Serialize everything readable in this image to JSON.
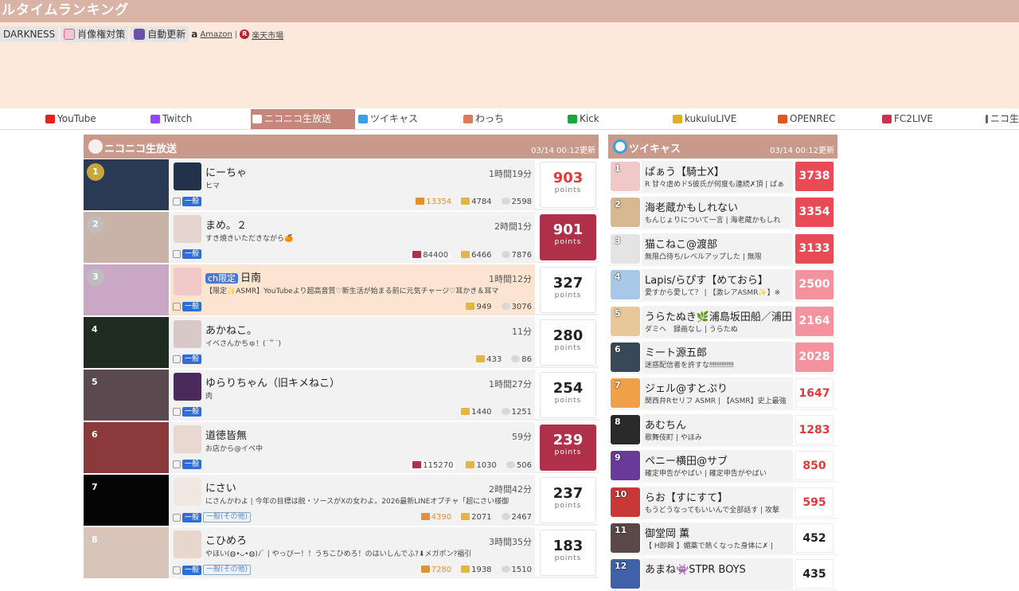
{
  "header": {
    "title": "ルタイムランキング"
  },
  "toolbar": {
    "darkness": "DARKNESS",
    "portrait": "肖像権対策",
    "auto_update": "自動更新",
    "amazon_mark": "a",
    "amazon": "Amazon",
    "separator": "|",
    "rakuten_mark": "R",
    "rakuten": "楽天市場"
  },
  "tabs": [
    {
      "label": "YouTube",
      "icon": "youtube-icon",
      "color": "#e62117"
    },
    {
      "label": "Twitch",
      "icon": "twitch-icon",
      "color": "#9146ff"
    },
    {
      "label": "ニコニコ生放送",
      "icon": "niconico-icon",
      "color": "#ffffff",
      "active": true
    },
    {
      "label": "ツイキャス",
      "icon": "twitcasting-icon",
      "color": "#3aa0e0"
    },
    {
      "label": "わっち",
      "icon": "wacchi-icon",
      "color": "#e07a5a"
    },
    {
      "label": "Kick",
      "icon": "kick-icon",
      "color": "#1aa83a"
    },
    {
      "label": "kukuluLIVE",
      "icon": "kukulu-icon",
      "color": "#e0b020"
    },
    {
      "label": "OPENREC",
      "icon": "openrec-icon",
      "color": "#e05520"
    },
    {
      "label": "FC2LIVE",
      "icon": "fc2-icon",
      "color": "#d03050"
    },
    {
      "label": "ニコ生",
      "icon": "niconico-icon",
      "color": "#666666"
    }
  ],
  "nico": {
    "title": "ニコニコ生放送",
    "updated": "03/14 00:12更新",
    "points_label": "points",
    "rows": [
      {
        "rank": "1",
        "name": "にーちゃ",
        "desc": "ヒマ",
        "time": "1時間19分",
        "tag": "一般",
        "gift": "13354",
        "viewers": "4784",
        "comments": "2598",
        "points": "903",
        "style": "red"
      },
      {
        "rank": "2",
        "name": "まめ。２",
        "desc": "すき焼きいただきながら🍊",
        "time": "2時間1分",
        "tag": "一般",
        "premium": "84400",
        "viewers": "6466",
        "comments": "7876",
        "points": "901",
        "style": "boost"
      },
      {
        "rank": "3",
        "badge": "ch限定",
        "name": "日南",
        "desc": "【限定✨ASMR】YouTubeより超高音質♡新生活が始まる前に元気チャージ♡耳かき＆耳マ",
        "time": "1時間12分",
        "tag": "一般",
        "viewers": "949",
        "comments": "3076",
        "points": "327",
        "style": "plain",
        "highlight": true
      },
      {
        "rank": "4",
        "name": "あかねこ。",
        "desc": "イベさんかちゅ！(˙꒳˙)",
        "time": "11分",
        "tag": "一般",
        "viewers": "433",
        "comments": "86",
        "points": "280",
        "style": "plain"
      },
      {
        "rank": "5",
        "name": "ゆらりちゃん（旧キメねこ）",
        "desc": "肉",
        "time": "1時間27分",
        "tag": "一般",
        "viewers": "1440",
        "comments": "1251",
        "points": "254",
        "style": "plain"
      },
      {
        "rank": "6",
        "name": "道徳皆無",
        "desc": "お店から@イベ中",
        "time": "59分",
        "tag": "一般",
        "premium": "115270",
        "viewers": "1030",
        "comments": "506",
        "points": "239",
        "style": "boost"
      },
      {
        "rank": "7",
        "name": "にさい",
        "desc": "にさんかわよ | 今年の目標は脱・ソースがXの女わよ。2026最新LINEオプチャ「超にさい様御",
        "time": "2時間42分",
        "tag": "一般",
        "tag2": "一般(その他)",
        "gift": "4390",
        "viewers": "2071",
        "comments": "2467",
        "points": "237",
        "style": "plain"
      },
      {
        "rank": "8",
        "name": "こひめろ",
        "desc": "やほい(◍•ᴗ•◍)ﾉﾞ | やっぴー！！うちこひめろ！のはいしんでふ?⬇メガポン?福引",
        "time": "3時間35分",
        "tag": "一般",
        "tag2": "一般(その他)",
        "gift": "7280",
        "viewers": "1938",
        "comments": "1510",
        "points": "183",
        "style": "plain"
      }
    ]
  },
  "twitcas": {
    "title": "ツイキャス",
    "updated": "03/14 00:12更新",
    "rows": [
      {
        "rank": "1",
        "name": "ぱぁう【騎士X】",
        "desc": "R 甘々虐めドS彼氏が何度も連続✗頂 | ぱぁ",
        "points": "3738",
        "style": "red"
      },
      {
        "rank": "2",
        "name": "海老蔵かもしれない",
        "desc": "もんじょりについて一言 | 海老蔵かもしれ",
        "points": "3354",
        "style": "red"
      },
      {
        "rank": "3",
        "name": "猫こねこ@渡部",
        "desc": "無限凸待ち/レベルアップした | 無限",
        "points": "3133",
        "style": "red"
      },
      {
        "rank": "4",
        "name": "Lapis/らぴす【めておら】",
        "desc": "愛すから愛して？ | 【激レアASMR✨】※",
        "points": "2500",
        "style": "pink"
      },
      {
        "rank": "5",
        "name": "うらたぬき🌿浦島坂田船／浦田",
        "desc": "ダミヘ　録画なし | うらたぬ",
        "points": "2164",
        "style": "pink"
      },
      {
        "rank": "6",
        "name": "ミート源五郎",
        "desc": "迷惑配信者を許すな‼‼‼‼‼‼‼",
        "points": "2028",
        "style": "pink"
      },
      {
        "rank": "7",
        "name": "ジェル@すとぷり",
        "desc": "関西弁Rセリフ ASMR | 【ASMR】史上最強",
        "points": "1647",
        "style": "light"
      },
      {
        "rank": "8",
        "name": "あむちん",
        "desc": "歌舞伎町 | やほみ",
        "points": "1283",
        "style": "light"
      },
      {
        "rank": "9",
        "name": "ペニー横田@サブ",
        "desc": "確定申告がやばい | 確定申告がやばい",
        "points": "850",
        "style": "light"
      },
      {
        "rank": "10",
        "name": "らお【すにすて】",
        "desc": "もうどうなってもいいんで全部話す | 攻撃",
        "points": "595",
        "style": "light"
      },
      {
        "rank": "11",
        "name": "御堂岡 薫",
        "desc": "【 H即興 】媚薬で熱くなった身体に✗ |",
        "points": "452",
        "style": "plain"
      },
      {
        "rank": "12",
        "name": "あまね👾STPR BOYS",
        "desc": "",
        "points": "435",
        "style": "plain"
      }
    ]
  }
}
